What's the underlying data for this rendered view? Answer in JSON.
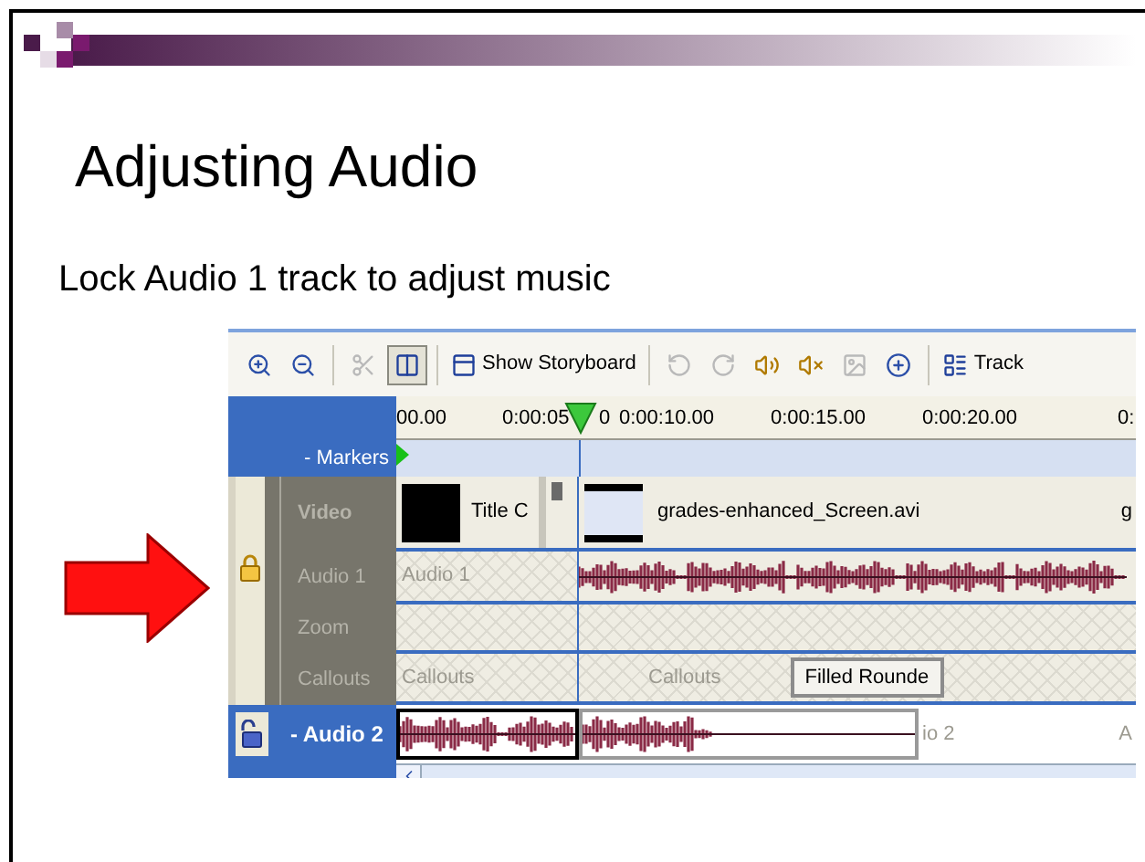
{
  "slide": {
    "title": "Adjusting Audio",
    "subtitle": "Lock Audio 1 track to adjust music"
  },
  "toolbar": [
    {
      "kind": "zoom-in",
      "disabled": false,
      "pressed": false
    },
    {
      "kind": "zoom-out",
      "disabled": false,
      "pressed": false
    },
    {
      "kind": "separator"
    },
    {
      "kind": "cut",
      "disabled": true,
      "pressed": false
    },
    {
      "kind": "split",
      "disabled": false,
      "pressed": true
    },
    {
      "kind": "separator"
    },
    {
      "kind": "button",
      "label": "Show Storyboard"
    },
    {
      "kind": "separator"
    },
    {
      "kind": "rotate-left",
      "disabled": true,
      "pressed": false
    },
    {
      "kind": "rotate-right",
      "disabled": true,
      "pressed": false
    },
    {
      "kind": "audio-up",
      "disabled": false,
      "pressed": false
    },
    {
      "kind": "audio-down",
      "disabled": false,
      "pressed": false
    },
    {
      "kind": "image",
      "disabled": true,
      "pressed": false
    },
    {
      "kind": "add",
      "disabled": false,
      "pressed": false
    },
    {
      "kind": "separator"
    },
    {
      "kind": "tracks",
      "label": "Track"
    }
  ],
  "ruler": {
    "labels": [
      "00.00",
      "0:00:05",
      "0",
      "0:00:10.00",
      "0:00:15.00",
      "0:00:20.00",
      "0:"
    ]
  },
  "markers": {
    "label": "- Markers"
  },
  "locked_group": {
    "locked": true,
    "tracks": [
      {
        "kind": "video",
        "label": "Video",
        "clips": [
          "Title C",
          "grades-enhanced_Screen.avi",
          "g"
        ]
      },
      {
        "kind": "audio",
        "label": "Audio 1",
        "clips": [
          "Audio 1"
        ]
      },
      {
        "kind": "zoom",
        "label": "Zoom"
      },
      {
        "kind": "callouts",
        "label": "Callouts",
        "clips": [
          "Callouts",
          "Callouts",
          "Filled Rounde"
        ]
      }
    ]
  },
  "audio2": {
    "label": "- Audio 2",
    "locked": false,
    "clips": [
      "io 2",
      "A"
    ]
  }
}
